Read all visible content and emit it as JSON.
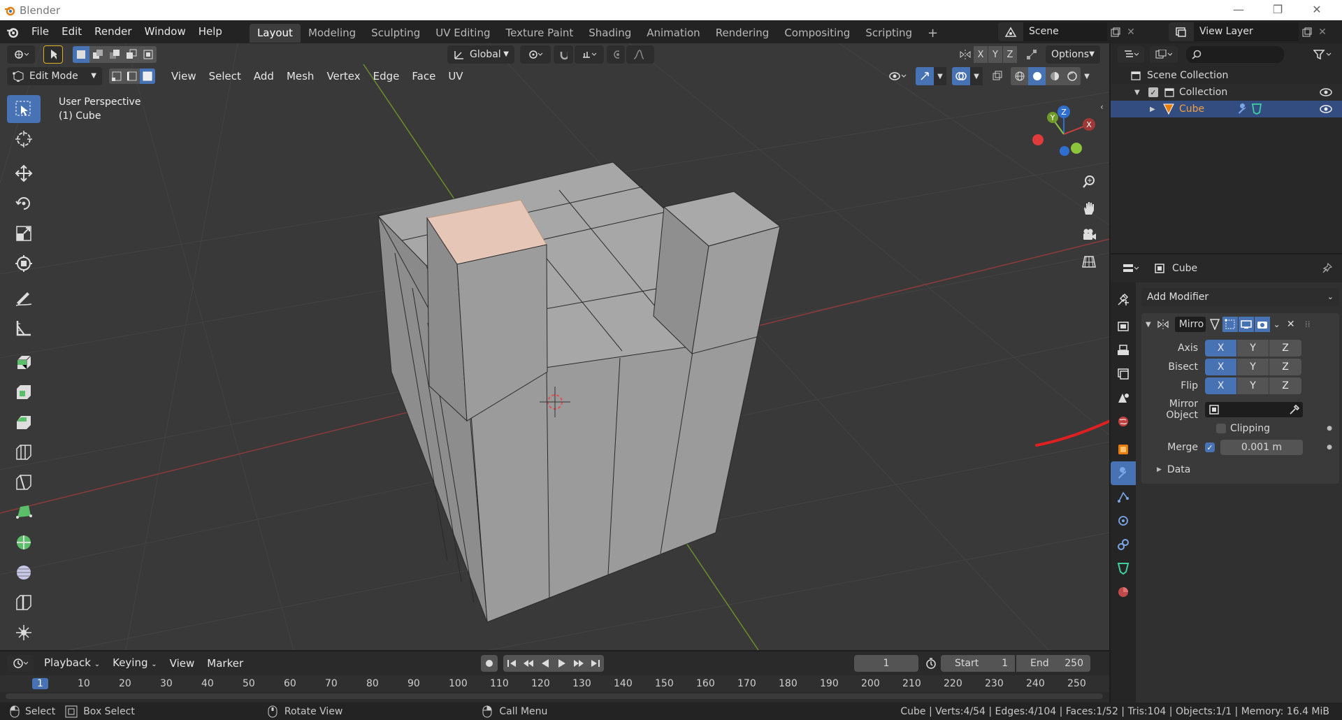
{
  "window": {
    "title": "Blender"
  },
  "menubar": {
    "items": [
      "File",
      "Edit",
      "Render",
      "Window",
      "Help"
    ]
  },
  "workspaces": [
    "Layout",
    "Modeling",
    "Sculpting",
    "UV Editing",
    "Texture Paint",
    "Shading",
    "Animation",
    "Rendering",
    "Compositing",
    "Scripting"
  ],
  "scene": {
    "label": "Scene",
    "view_layer": "View Layer"
  },
  "viewport": {
    "mode": "Edit Mode",
    "menus": [
      "View",
      "Select",
      "Add",
      "Mesh",
      "Vertex",
      "Edge",
      "Face",
      "UV"
    ],
    "transform_orientation": "Global",
    "options_label": "Options",
    "axis_toggles": [
      "X",
      "Y",
      "Z"
    ],
    "overlay_title": "User Perspective",
    "overlay_object": "(1) Cube",
    "gizmo": {
      "x": "X",
      "y": "Y",
      "z": "Z"
    }
  },
  "outliner": {
    "scene_collection": "Scene Collection",
    "collection": "Collection",
    "object": "Cube"
  },
  "properties": {
    "object_name": "Cube",
    "add_modifier": "Add Modifier",
    "modifier_name": "Mirro",
    "rows": [
      {
        "label": "Axis",
        "buttons": [
          "X",
          "Y",
          "Z"
        ],
        "active": [
          true,
          false,
          false
        ]
      },
      {
        "label": "Bisect",
        "buttons": [
          "X",
          "Y",
          "Z"
        ],
        "active": [
          true,
          false,
          false
        ]
      },
      {
        "label": "Flip",
        "buttons": [
          "X",
          "Y",
          "Z"
        ],
        "active": [
          true,
          false,
          false
        ]
      }
    ],
    "mirror_object_label": "Mirror Object",
    "clipping_label": "Clipping",
    "merge_label": "Merge",
    "merge_value": "0.001 m",
    "data_label": "Data"
  },
  "timeline": {
    "menus": [
      "Playback",
      "Keying",
      "View",
      "Marker"
    ],
    "current_frame": "1",
    "start_label": "Start",
    "start_value": "1",
    "end_label": "End",
    "end_value": "250",
    "ruler": [
      "1",
      "10",
      "20",
      "30",
      "40",
      "50",
      "60",
      "70",
      "80",
      "90",
      "100",
      "110",
      "120",
      "130",
      "140",
      "150",
      "160",
      "170",
      "180",
      "190",
      "200",
      "210",
      "220",
      "230",
      "240",
      "250"
    ]
  },
  "statusbar": {
    "select": "Select",
    "box_select": "Box Select",
    "rotate_view": "Rotate View",
    "call_menu": "Call Menu",
    "stats": "Cube | Verts:4/54 | Edges:4/104 | Faces:1/52 | Tris:104 | Objects:1/1 | Memory: 16.4 MiB"
  },
  "colors": {
    "accent": "#4772b3",
    "selected_face": "#e6c6b6",
    "annotation": "#e02020",
    "x_axis": "#c84040",
    "y_axis": "#8cc43c"
  }
}
